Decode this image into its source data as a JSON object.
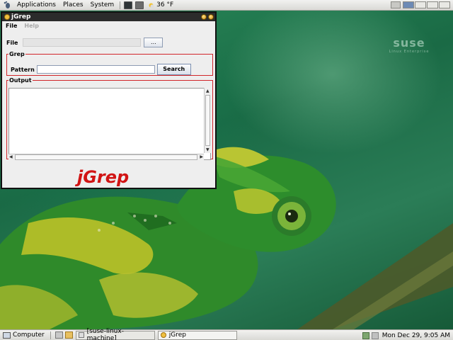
{
  "top_panel": {
    "menus": [
      "Applications",
      "Places",
      "System"
    ],
    "weather": "36 °F",
    "workspaces": 4
  },
  "window": {
    "title": "jGrep",
    "menu": {
      "file": "File",
      "help": "Help"
    },
    "file_label": "File",
    "file_value": "",
    "browse_label": "...",
    "grep_group": "Grep",
    "pattern_label": "Pattern",
    "pattern_value": "",
    "search_label": "Search",
    "output_group": "Output",
    "output_text": "",
    "logo_text": "jGrep"
  },
  "desktop": {
    "logo_word": "suse",
    "logo_sub": "Linux Enterprise"
  },
  "bottom_panel": {
    "computer_label": "Computer",
    "tasks": [
      "[suse-linux-machine]",
      "jGrep"
    ],
    "clock": "Mon Dec 29,  9:05 AM"
  },
  "colors": {
    "accent_red": "#d1262a",
    "logo_red": "#d11414",
    "titlebar": "#2b2b2b"
  }
}
